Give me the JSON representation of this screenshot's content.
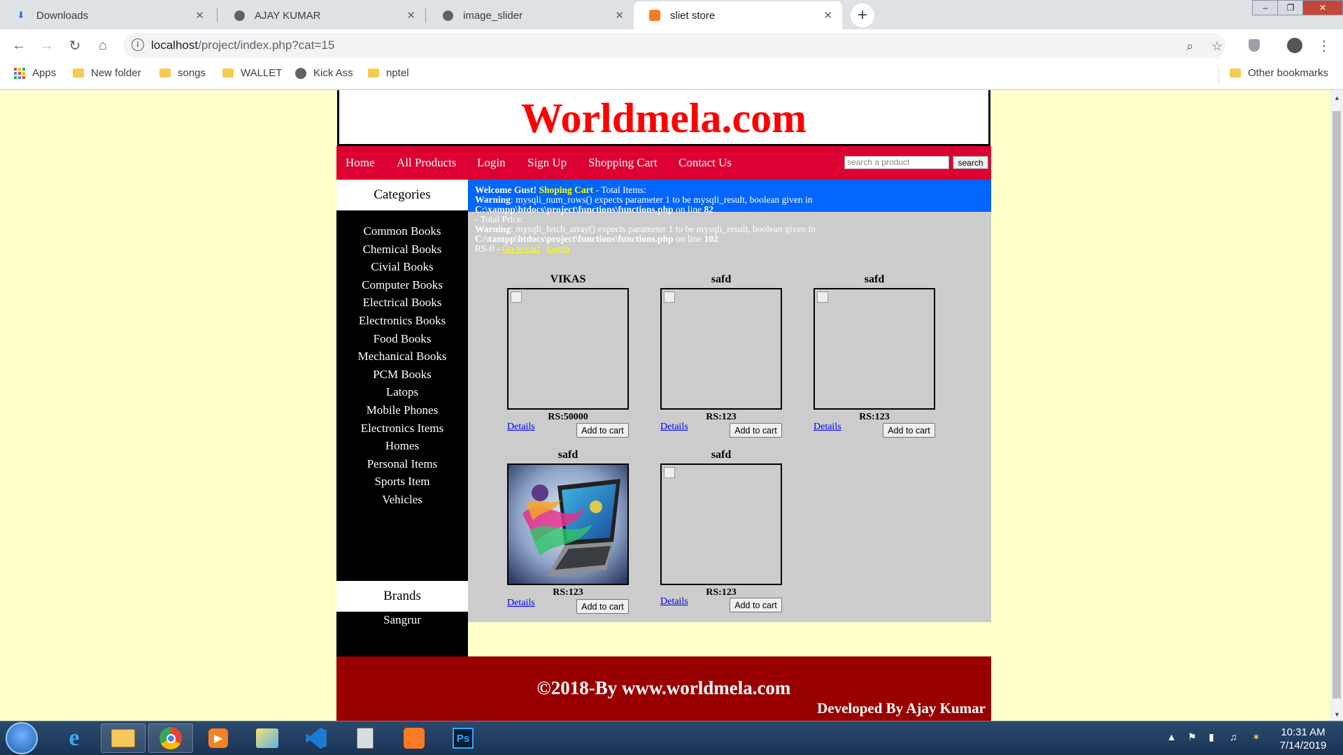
{
  "browser": {
    "tabs": [
      {
        "title": "Downloads",
        "icon": "download-icon"
      },
      {
        "title": "AJAY KUMAR",
        "icon": "globe-icon"
      },
      {
        "title": "image_slider",
        "icon": "globe-icon"
      },
      {
        "title": "sliet store",
        "icon": "xampp-icon"
      }
    ],
    "url_host": "localhost",
    "url_rest": "/project/index.php?cat=15",
    "bookmarks": [
      "Apps",
      "New folder",
      "songs",
      "WALLET",
      "Kick Ass",
      "nptel"
    ],
    "other_bookmarks": "Other bookmarks"
  },
  "site": {
    "logo": "Worldmela.com",
    "menu": [
      "Home",
      "All Products",
      "Login",
      "Sign Up",
      "Shopping Cart",
      "Contact Us"
    ],
    "search_placeholder": "search a product",
    "search_button": "search",
    "categories_heading": "Categories",
    "categories": [
      "Common Books",
      "Chemical Books",
      "Civial Books",
      "Computer Books",
      "Electrical Books",
      "Electronics Books",
      "Food Books",
      "Mechanical Books",
      "PCM Books",
      "Latops",
      "Mobile Phones",
      "Electronics Items",
      "Homes",
      "Personal Items",
      "Sports Item",
      "Vehicles"
    ],
    "brands_heading": "Brands",
    "brands": [
      "Sangrur"
    ],
    "cart": {
      "welcome": "Welcome Gust!",
      "shopping_cart": "Shoping Cart",
      "total_items": " - Total Items:",
      "warning_label": "Warning",
      "warning1_text": ": mysqli_num_rows() expects parameter 1 to be mysqli_result, boolean given in",
      "warning1_path": "C:\\xampp\\htdocs\\project\\functions\\functions.php",
      "warning1_online": " on line ",
      "warning1_line": "82",
      "total_price": "- Total Price:",
      "warning2_text": ": mysqli_fetch_array() expects parameter 1 to be mysqli_result, boolean given in",
      "warning2_path": "C:\\xampp\\htdocs\\project\\functions\\functions.php",
      "warning2_online": " on line ",
      "warning2_line": "102",
      "rs": "RS-0 - ",
      "go_to_cart": "Go to cart",
      "login": "Login"
    },
    "products": [
      {
        "title": "VIKAS",
        "price": "RS:50000",
        "image": "broken"
      },
      {
        "title": "safd",
        "price": "RS:123",
        "image": "broken"
      },
      {
        "title": "safd",
        "price": "RS:123",
        "image": "broken"
      },
      {
        "title": "safd",
        "price": "RS:123",
        "image": "laptop"
      },
      {
        "title": "safd",
        "price": "RS:123",
        "image": "broken"
      }
    ],
    "details_label": "Details",
    "add_to_cart_label": "Add to cart",
    "footer_copy": "©2018-By www.worldmela.com",
    "footer_dev": "Developed By Ajay Kumar"
  },
  "taskbar": {
    "time": "10:31 AM",
    "date": "7/14/2019",
    "apps": [
      "ie-icon",
      "explorer-icon",
      "chrome-icon",
      "media-player-icon",
      "paint-icon",
      "vscode-icon",
      "calculator-icon",
      "xampp-icon",
      "photoshop-icon"
    ]
  },
  "colors": {
    "page_bg": "#ffffcc",
    "logo": "#ff0000",
    "menubar": "#dd0033",
    "welcome_bar": "#0066ff",
    "content_bg": "#cccccc",
    "footer": "#990000"
  }
}
